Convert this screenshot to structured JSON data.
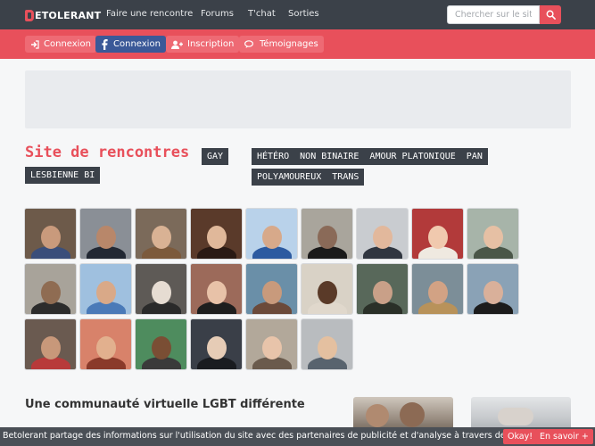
{
  "topnav": {
    "logo_text": "ETOLERANT",
    "links": [
      "Faire une rencontre",
      "Forums",
      "T'chat",
      "Sorties"
    ],
    "search_placeholder": "Chercher sur le site"
  },
  "subnav": {
    "buttons": [
      {
        "label": "Connexion",
        "icon": "sign-in-icon"
      },
      {
        "label": "Connexion",
        "icon": "facebook-icon"
      },
      {
        "label": "Inscription",
        "icon": "user-plus-icon"
      },
      {
        "label": "Témoignages",
        "icon": "comments-icon"
      }
    ]
  },
  "hero": {
    "title": "Site de rencontres",
    "tags_left": [
      "GAY",
      "LESBIENNE BI"
    ],
    "tags_right": [
      "HÉTÉRO  NON BINAIRE  AMOUR PLATONIQUE  PAN",
      "POLYAMOUREUX  TRANS"
    ]
  },
  "profiles": {
    "rows": [
      [
        {
          "bg": "#6d5a4a",
          "skin": "#c99a7c",
          "shirt": "#3a4e7a"
        },
        {
          "bg": "#8a8f96",
          "skin": "#b8876a",
          "shirt": "#222833"
        },
        {
          "bg": "#7b6a5a",
          "skin": "#d9b294",
          "shirt": "#7c5a3c"
        },
        {
          "bg": "#5a3a2a",
          "skin": "#e0b89a",
          "shirt": "#2a1a14"
        },
        {
          "bg": "#b9d2ea",
          "skin": "#d7a98a",
          "shirt": "#2c5aa0"
        },
        {
          "bg": "#a9a59c",
          "skin": "#8a6a58",
          "shirt": "#1a1a1a"
        },
        {
          "bg": "#c9ccd0",
          "skin": "#e2b89c",
          "shirt": "#303640"
        },
        {
          "bg": "#b23a3a",
          "skin": "#f0c9ae",
          "shirt": "#efe9e0"
        },
        {
          "bg": "#a7b4a9",
          "skin": "#e6c0a4",
          "shirt": "#4a5648"
        }
      ],
      [
        {
          "bg": "#a8a39a",
          "skin": "#8f6c52",
          "shirt": "#2c2c2c"
        },
        {
          "bg": "#9fc0df",
          "skin": "#d9a988",
          "shirt": "#4a7ab8"
        },
        {
          "bg": "#5e5a56",
          "skin": "#e6dcd2",
          "shirt": "#2a2a2a"
        },
        {
          "bg": "#9c6a5a",
          "skin": "#e8c2a8",
          "shirt": "#1e1e1e"
        },
        {
          "bg": "#6a8fa8",
          "skin": "#c89a7c",
          "shirt": "#6b4a3a"
        },
        {
          "bg": "#d9d2c6",
          "skin": "#5a3a28",
          "shirt": "#e0d8cc"
        },
        {
          "bg": "#58685a",
          "skin": "#c9a088",
          "shirt": "#2a3028"
        },
        {
          "bg": "#7c8e98",
          "skin": "#d2a284",
          "shirt": "#b8925a"
        },
        {
          "bg": "#8aa2b6",
          "skin": "#d9b09a",
          "shirt": "#1c1c1c"
        }
      ],
      [
        {
          "bg": "#6a5a50",
          "skin": "#c8987a",
          "shirt": "#b83a3a"
        },
        {
          "bg": "#d8826a",
          "skin": "#e2b08e",
          "shirt": "#8a3a2a"
        },
        {
          "bg": "#4e8c5e",
          "skin": "#7a4e34",
          "shirt": "#3a3a3a"
        },
        {
          "bg": "#3a3f48",
          "skin": "#e6ccb6",
          "shirt": "#1a1c20"
        },
        {
          "bg": "#b2a89a",
          "skin": "#e8c4aa",
          "shirt": "#6a5a4c"
        },
        {
          "bg": "#b9bcbf",
          "skin": "#e4c0a0",
          "shirt": "#58636e"
        }
      ]
    ]
  },
  "bottom": {
    "section_title": "Une communauté virtuelle LGBT différente"
  },
  "cookie": {
    "text": "Betolerant partage des informations sur l'utilisation du site avec des partenaires de publicité et d'analyse à travers des cookies.",
    "ok_label": "Okay!",
    "more_label": "En savoir +"
  },
  "colors": {
    "accent": "#e8505b",
    "nav_bg": "#3b4149",
    "facebook": "#3b5998"
  }
}
